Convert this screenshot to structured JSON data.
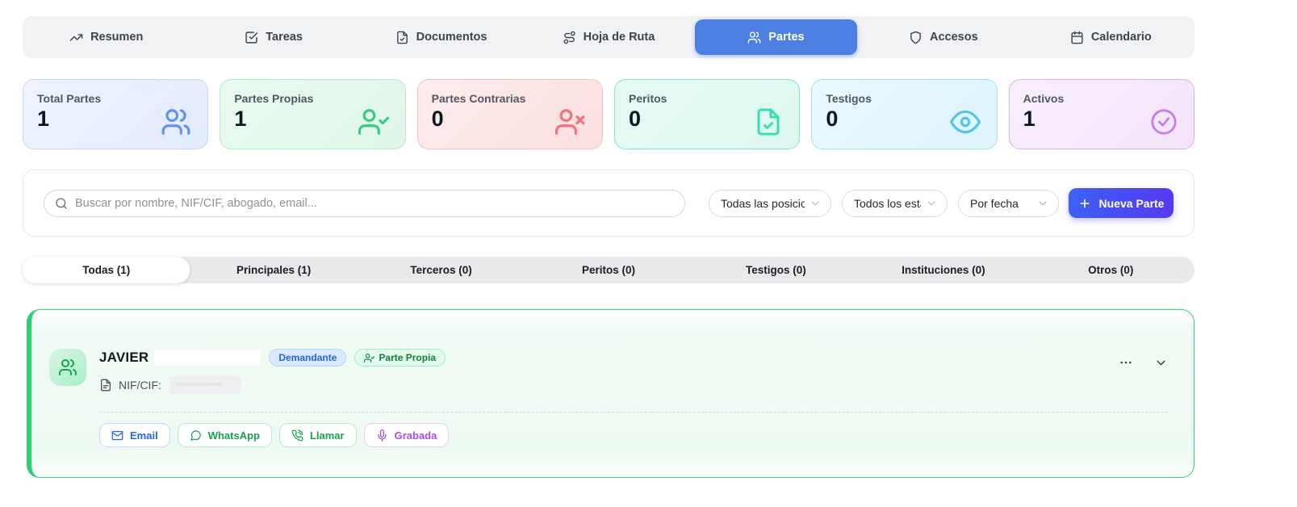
{
  "nav": {
    "tabs": [
      {
        "label": "Resumen",
        "icon": "trending-up"
      },
      {
        "label": "Tareas",
        "icon": "check-square"
      },
      {
        "label": "Documentos",
        "icon": "file-check"
      },
      {
        "label": "Hoja de Ruta",
        "icon": "route"
      },
      {
        "label": "Partes",
        "icon": "users",
        "active": true
      },
      {
        "label": "Accesos",
        "icon": "shield"
      },
      {
        "label": "Calendario",
        "icon": "calendar"
      }
    ]
  },
  "stats": [
    {
      "label": "Total Partes",
      "value": "1",
      "icon": "users",
      "accent": "#6392ef"
    },
    {
      "label": "Partes Propias",
      "value": "1",
      "icon": "user-check",
      "accent": "#3dc983"
    },
    {
      "label": "Partes Contrarias",
      "value": "0",
      "icon": "user-x",
      "accent": "#f2717c"
    },
    {
      "label": "Peritos",
      "value": "0",
      "icon": "file-check",
      "accent": "#3bdcb8"
    },
    {
      "label": "Testigos",
      "value": "0",
      "icon": "eye",
      "accent": "#54c5e9"
    },
    {
      "label": "Activos",
      "value": "1",
      "icon": "check-circle",
      "accent": "#c87bea"
    }
  ],
  "toolbar": {
    "search_placeholder": "Buscar por nombre, NIF/CIF, abogado, email...",
    "position_filter": "Todas las posicion",
    "status_filter": "Todos los estad",
    "date_filter": "Por fecha",
    "new_party_label": "Nueva Parte"
  },
  "category_tabs": [
    {
      "label": "Todas (1)",
      "active": true
    },
    {
      "label": "Principales (1)"
    },
    {
      "label": "Terceros (0)"
    },
    {
      "label": "Peritos (0)"
    },
    {
      "label": "Testigos (0)"
    },
    {
      "label": "Instituciones (0)"
    },
    {
      "label": "Otros (0)"
    }
  ],
  "party": {
    "name": "JAVIER",
    "role_badge": "Demandante",
    "own_badge": "Parte Propia",
    "nif_label": "NIF/CIF:",
    "actions": {
      "email": "Email",
      "whatsapp": "WhatsApp",
      "call": "Llamar",
      "recorded": "Grabada"
    }
  },
  "colors": {
    "active_tab_blue": "#4d7fe3",
    "new_button_gradient": [
      "#3c61f6",
      "#5639f0"
    ],
    "party_card_border_green": "#2ed573",
    "badge_blue_text": "#2563eb",
    "badge_green_text": "#15803d",
    "recorded_purple": "#a24bf0"
  }
}
